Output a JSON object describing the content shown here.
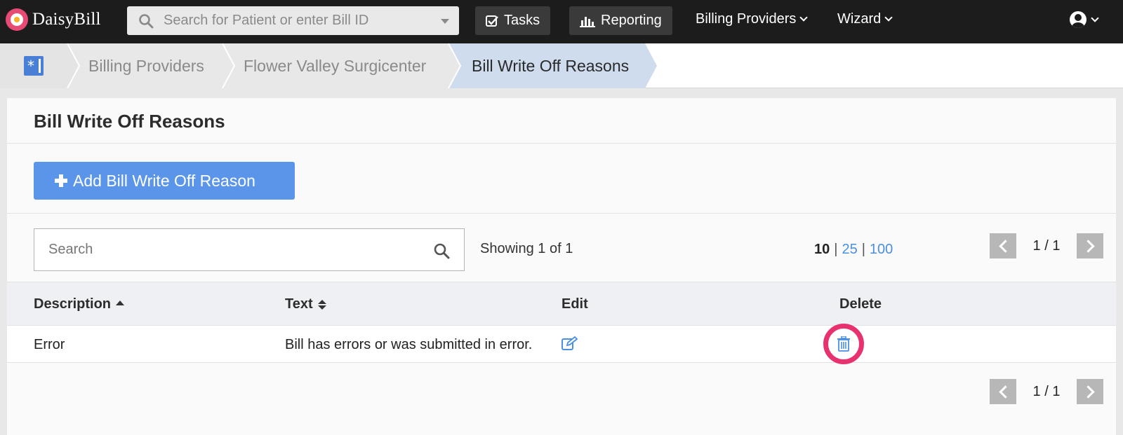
{
  "app": {
    "name": "DaisyBill"
  },
  "topnav": {
    "search_placeholder": "Search for Patient or enter Bill ID",
    "tasks": "Tasks",
    "reporting": "Reporting",
    "billing_providers": "Billing Providers",
    "wizard": "Wizard"
  },
  "breadcrumb": {
    "items": [
      "Billing Providers",
      "Flower Valley Surgicenter",
      "Bill Write Off Reasons"
    ]
  },
  "page": {
    "title": "Bill Write Off Reasons",
    "add_button": "Add Bill Write Off Reason",
    "search_placeholder": "Search",
    "showing": "Showing 1 of 1",
    "page_sizes": {
      "current": "10",
      "options": [
        "25",
        "100"
      ],
      "separator": "|"
    },
    "pagination": "1 / 1"
  },
  "table": {
    "headers": [
      "Description",
      "Text",
      "Edit",
      "Delete"
    ],
    "rows": [
      {
        "description": "Error",
        "text": "Bill has errors or was submitted in error."
      }
    ]
  },
  "colors": {
    "accent": "#5b95e9",
    "link": "#4a8fe0",
    "highlight_ring": "#e8316f",
    "active_crumb": "#cfdcee"
  }
}
